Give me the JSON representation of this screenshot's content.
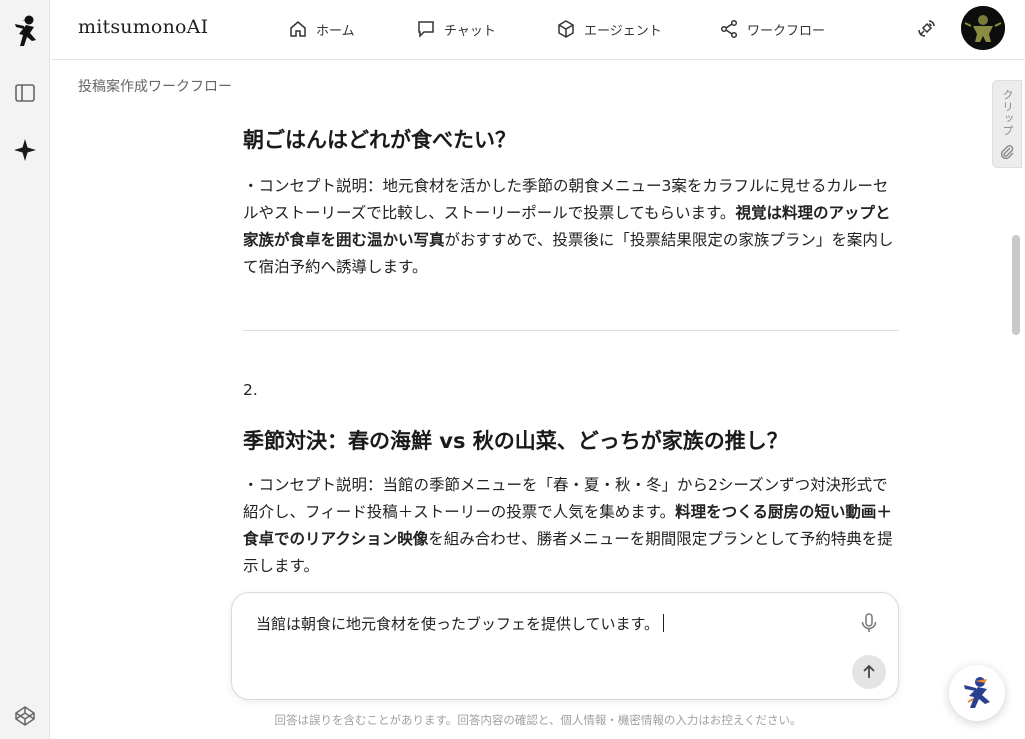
{
  "app": {
    "brand": "mitsumonoAI"
  },
  "nav": [
    {
      "label": "ホーム",
      "icon": "home-icon"
    },
    {
      "label": "チャット",
      "icon": "chat-icon"
    },
    {
      "label": "エージェント",
      "icon": "cube-icon"
    },
    {
      "label": "ワークフロー",
      "icon": "share-icon"
    }
  ],
  "breadcrumb": "投稿案作成ワークフロー",
  "clip_tab": "クリップ",
  "content": {
    "section1": {
      "title": "朝ごはんはどれが食べたい？",
      "p_a": "・コンセプト説明：地元食材を活かした季節の朝食メニュー3案をカラフルに見せるカルーセルやストーリーズで比較し、ストーリーポールで投票してもらいます。",
      "p_bold": "視覚は料理のアップと家族が食卓を囲む温かい写真",
      "p_b": "がおすすめで、投票後に「投票結果限定の家族プラン」を案内して宿泊予約へ誘導します。"
    },
    "section2": {
      "number": "2.",
      "title": "季節対決：春の海鮮 vs 秋の山菜、どっちが家族の推し？",
      "p_a": "・コンセプト説明：当館の季節メニューを「春・夏・秋・冬」から2シーズンずつ対決形式で紹介し、フィード投稿＋ストーリーの投票で人気を集めます。",
      "p_bold": "料理をつくる厨房の短い動画＋食卓でのリアクション映像",
      "p_b": "を組み合わせ、勝者メニューを期間限定プランとして予約特典を提示します。"
    }
  },
  "composer": {
    "value": "当館は朝食に地元食材を使ったブッフェを提供しています。"
  },
  "disclaimer": "回答は誤りを含むことがあります。回答内容の確認と、個人情報・機密情報の入力はお控えください。"
}
